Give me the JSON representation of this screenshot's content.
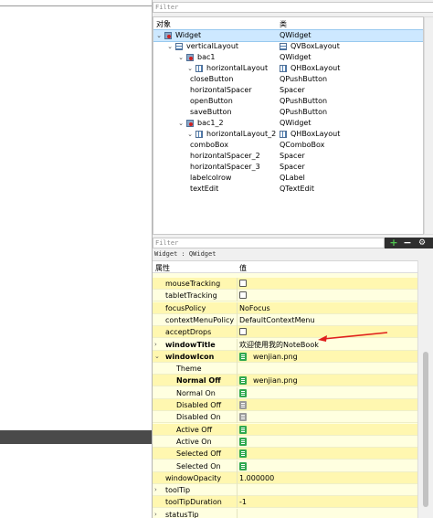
{
  "object_inspector": {
    "filter_placeholder": "Filter",
    "col_object": "对象",
    "col_class": "类",
    "rows": [
      {
        "name": "Widget",
        "cls": "QWidget",
        "arrow": "⌄",
        "icon": "widget",
        "cicon": "",
        "sel": true
      },
      {
        "name": "verticalLayout",
        "cls": "QVBoxLayout",
        "arrow": "⌄",
        "icon": "vbox",
        "cicon": "vbox"
      },
      {
        "name": "bac1",
        "cls": "QWidget",
        "arrow": "⌄",
        "icon": "widget",
        "cicon": ""
      },
      {
        "name": "horizontalLayout",
        "cls": "QHBoxLayout",
        "arrow": "⌄",
        "icon": "hbox",
        "cicon": "hbox"
      },
      {
        "name": "closeButton",
        "cls": "QPushButton",
        "arrow": "",
        "icon": "",
        "cicon": ""
      },
      {
        "name": "horizontalSpacer",
        "cls": "Spacer",
        "arrow": "",
        "icon": "",
        "cicon": ""
      },
      {
        "name": "openButton",
        "cls": "QPushButton",
        "arrow": "",
        "icon": "",
        "cicon": ""
      },
      {
        "name": "saveButton",
        "cls": "QPushButton",
        "arrow": "",
        "icon": "",
        "cicon": ""
      },
      {
        "name": "bac1_2",
        "cls": "QWidget",
        "arrow": "⌄",
        "icon": "widget",
        "cicon": ""
      },
      {
        "name": "horizontalLayout_2",
        "cls": "QHBoxLayout",
        "arrow": "⌄",
        "icon": "hbox",
        "cicon": "hbox"
      },
      {
        "name": "comboBox",
        "cls": "QComboBox",
        "arrow": "",
        "icon": "",
        "cicon": ""
      },
      {
        "name": "horizontalSpacer_2",
        "cls": "Spacer",
        "arrow": "",
        "icon": "",
        "cicon": ""
      },
      {
        "name": "horizontalSpacer_3",
        "cls": "Spacer",
        "arrow": "",
        "icon": "",
        "cicon": ""
      },
      {
        "name": "labelcolrow",
        "cls": "QLabel",
        "arrow": "",
        "icon": "",
        "cicon": ""
      },
      {
        "name": "textEdit",
        "cls": "QTextEdit",
        "arrow": "",
        "icon": "",
        "cicon": ""
      }
    ]
  },
  "property_editor": {
    "filter_placeholder": "Filter",
    "add_label": "+",
    "remove_label": "−",
    "config_label": "⚙",
    "class_line": "Widget : QWidget",
    "col_property": "属性",
    "col_value": "值",
    "rows": [
      {
        "name": "mouseTracking",
        "value": "",
        "kind": "check",
        "arrow": "",
        "bold": false
      },
      {
        "name": "tabletTracking",
        "value": "",
        "kind": "check",
        "arrow": "",
        "bold": false
      },
      {
        "name": "focusPolicy",
        "value": "NoFocus",
        "kind": "text",
        "arrow": "",
        "bold": false
      },
      {
        "name": "contextMenuPolicy",
        "value": "DefaultContextMenu",
        "kind": "text",
        "arrow": "",
        "bold": false
      },
      {
        "name": "acceptDrops",
        "value": "",
        "kind": "check",
        "arrow": "",
        "bold": false
      },
      {
        "name": "windowTitle",
        "value": "欢迎使用我的NoteBook",
        "kind": "text",
        "arrow": "›",
        "bold": true
      },
      {
        "name": "windowIcon",
        "value": "wenjian.png",
        "kind": "file",
        "arrow": "⌄",
        "bold": true
      },
      {
        "name": "Theme",
        "value": "",
        "kind": "text",
        "arrow": "",
        "bold": false
      },
      {
        "name": "Normal Off",
        "value": "wenjian.png",
        "kind": "file",
        "arrow": "",
        "bold": true
      },
      {
        "name": "Normal On",
        "value": "",
        "kind": "file",
        "arrow": "",
        "bold": false
      },
      {
        "name": "Disabled Off",
        "value": "",
        "kind": "filegray",
        "arrow": "",
        "bold": false
      },
      {
        "name": "Disabled On",
        "value": "",
        "kind": "filegray",
        "arrow": "",
        "bold": false
      },
      {
        "name": "Active Off",
        "value": "",
        "kind": "file",
        "arrow": "",
        "bold": false
      },
      {
        "name": "Active On",
        "value": "",
        "kind": "file",
        "arrow": "",
        "bold": false
      },
      {
        "name": "Selected Off",
        "value": "",
        "kind": "file",
        "arrow": "",
        "bold": false
      },
      {
        "name": "Selected On",
        "value": "",
        "kind": "file",
        "arrow": "",
        "bold": false
      },
      {
        "name": "windowOpacity",
        "value": "1.000000",
        "kind": "text",
        "arrow": "",
        "bold": false
      },
      {
        "name": "toolTip",
        "value": "",
        "kind": "text",
        "arrow": "›",
        "bold": false
      },
      {
        "name": "toolTipDuration",
        "value": "-1",
        "kind": "text",
        "arrow": "",
        "bold": false
      },
      {
        "name": "statusTip",
        "value": "",
        "kind": "text",
        "arrow": "›",
        "bold": false
      }
    ]
  },
  "colors": {
    "selection": "#cde8ff",
    "property_bg": "#ffffe0",
    "property_alt_bg": "#fff7b0",
    "annotation_arrow": "#e0201c",
    "file_icon": "#2fa84f"
  }
}
